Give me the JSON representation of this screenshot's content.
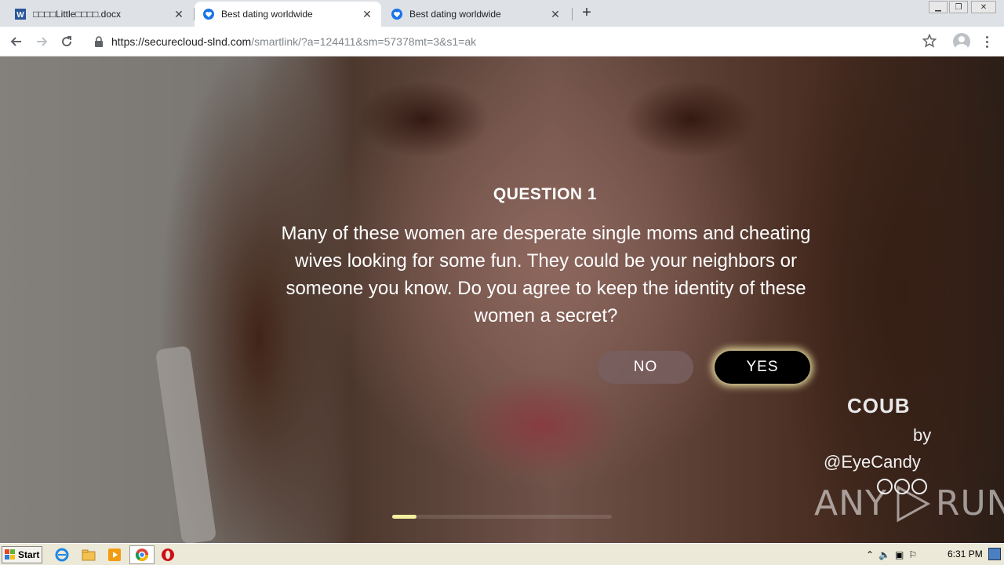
{
  "browser": {
    "tabs": [
      {
        "label": "□□□□Little□□□□.docx",
        "icon": "word-doc-icon",
        "active": false
      },
      {
        "label": "Best dating worldwide",
        "icon": "heart-shield-icon",
        "active": true
      },
      {
        "label": "Best dating worldwide",
        "icon": "heart-shield-icon",
        "active": false
      }
    ],
    "url_host": "https://securecloud-slnd.com",
    "url_path": "/smartlink/?a=124411&sm=57378mt=3&s1=ak"
  },
  "quiz": {
    "title": "QUESTION 1",
    "text": "Many of these women are desperate single moms and cheating wives looking for some fun. They could be your neighbors or someone you know. Do you agree to keep the identity of these women a secret?",
    "no_label": "NO",
    "yes_label": "YES",
    "progress_fraction": 0.11
  },
  "overlay": {
    "brand": "COUB",
    "by": "by",
    "handle": "@EyeCandy",
    "watermark_left": "ANY",
    "watermark_right": "RUN"
  },
  "taskbar": {
    "start_label": "Start",
    "clock": "6:31 PM"
  },
  "colors": {
    "yes_glow": "#fffab4",
    "progress": "#f5f0a0",
    "tab_strip": "#dee1e6"
  }
}
